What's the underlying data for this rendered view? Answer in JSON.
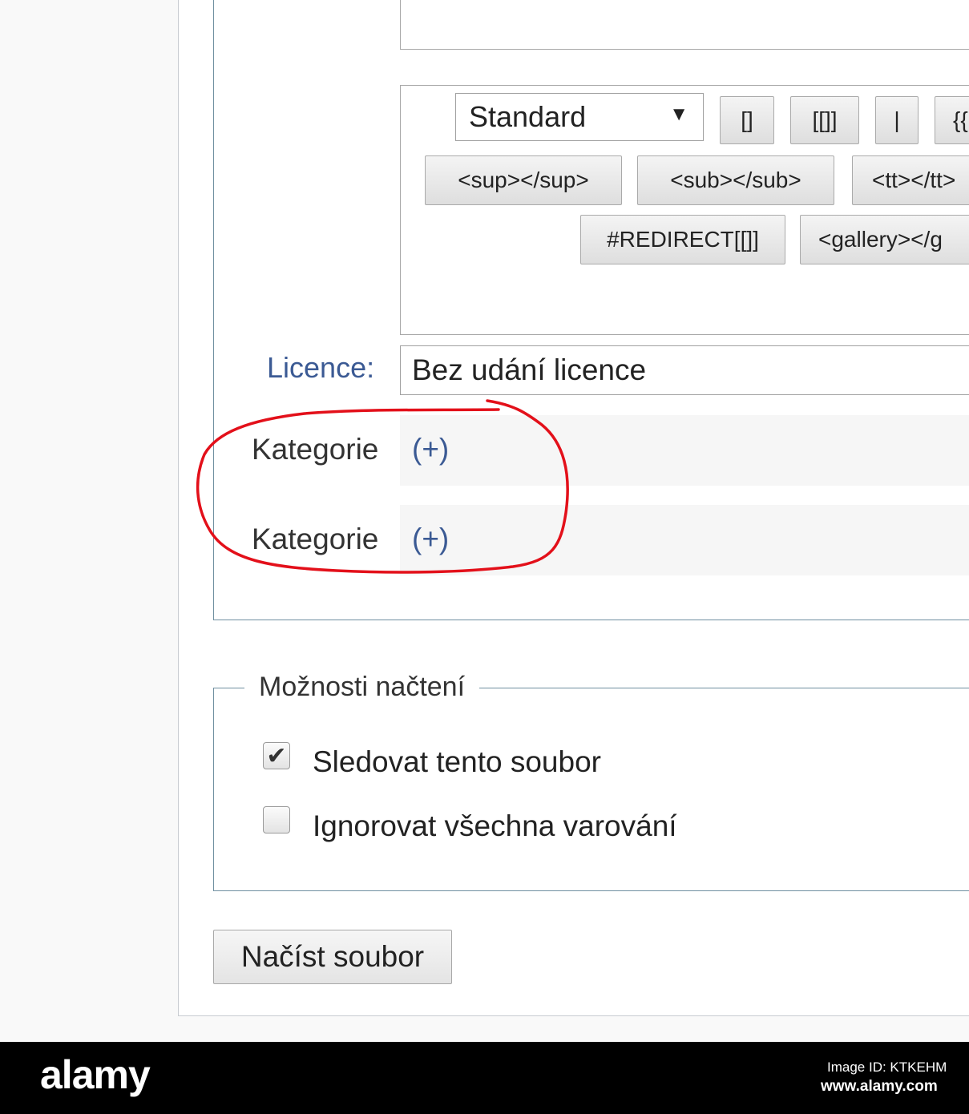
{
  "toolbar": {
    "style_select_value": "Standard",
    "buttons_row1": [
      "[]",
      "[[]]",
      "|",
      "{{"
    ],
    "buttons_row2": [
      "<sup></sup>",
      "<sub></sub>",
      "<tt></tt>"
    ],
    "buttons_row3": [
      "#REDIRECT[[]]",
      "<gallery></g"
    ]
  },
  "licence": {
    "label": "Licence:",
    "value": "Bez udání licence"
  },
  "categories": [
    {
      "label": "Kategorie",
      "add": "(+)"
    },
    {
      "label": "Kategorie",
      "add": "(+)"
    }
  ],
  "upload_options": {
    "legend": "Možnosti načtení",
    "watch": {
      "label": "Sledovat tento soubor",
      "checked": true
    },
    "ignore_warnings": {
      "label": "Ignorovat všechna varování",
      "checked": false
    }
  },
  "submit": {
    "label": "Načíst soubor"
  },
  "annotation": {
    "color": "#e3101a"
  },
  "watermark": {
    "brand": "alamy",
    "image_id": "Image ID: KTKEHM",
    "url": "www.alamy.com"
  }
}
